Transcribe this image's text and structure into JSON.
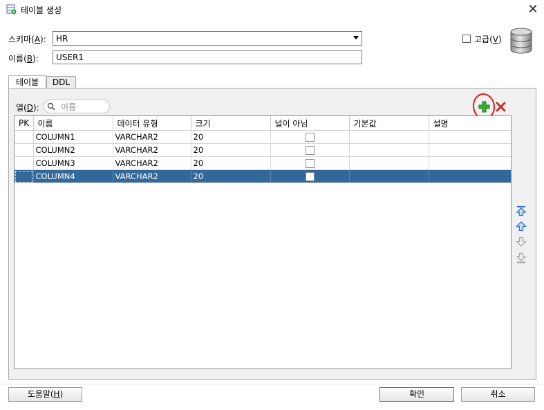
{
  "window": {
    "title": "테이블 생성",
    "close_label": "✕"
  },
  "form": {
    "schema_label_prefix": "스키마(",
    "schema_label_key": "A",
    "schema_label_suffix": "):",
    "schema_value": "HR",
    "name_label_prefix": "이름(",
    "name_label_key": "B",
    "name_label_suffix": "):",
    "name_value": "USER1",
    "advanced_label_prefix": "고급(",
    "advanced_label_key": "V",
    "advanced_label_suffix": ")",
    "advanced_checked": false
  },
  "tabs": [
    {
      "label": "테이블",
      "active": true
    },
    {
      "label": "DDL",
      "active": false
    }
  ],
  "columns_panel": {
    "label_prefix": "열(",
    "label_key": "D",
    "label_suffix": "):",
    "search_placeholder": "이름"
  },
  "table": {
    "headers": [
      "PK",
      "이름",
      "데이터 유형",
      "크기",
      "널이 아님",
      "기본값",
      "설명"
    ],
    "rows": [
      {
        "pk": "",
        "name": "COLUMN1",
        "type": "VARCHAR2",
        "size": "20",
        "not_null": false,
        "default": "",
        "comment": "",
        "selected": false
      },
      {
        "pk": "",
        "name": "COLUMN2",
        "type": "VARCHAR2",
        "size": "20",
        "not_null": false,
        "default": "",
        "comment": "",
        "selected": false
      },
      {
        "pk": "",
        "name": "COLUMN3",
        "type": "VARCHAR2",
        "size": "20",
        "not_null": false,
        "default": "",
        "comment": "",
        "selected": false
      },
      {
        "pk": "",
        "name": "COLUMN4",
        "type": "VARCHAR2",
        "size": "20",
        "not_null": false,
        "default": "",
        "comment": "",
        "selected": true
      }
    ]
  },
  "buttons": {
    "help_prefix": "도움말(",
    "help_key": "H",
    "help_suffix": ")",
    "ok": "확인",
    "cancel": "취소"
  },
  "colors": {
    "selection": "#34689b",
    "annotation": "#e0191b",
    "add_icon": "#2ea02e",
    "delete_icon": "#d42b1e"
  }
}
